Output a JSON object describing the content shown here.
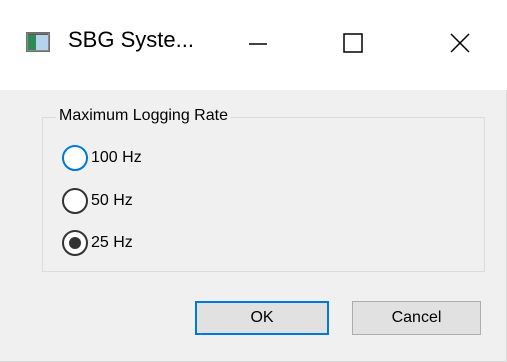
{
  "window": {
    "title": "SBG Syste...",
    "icon": "app-window-icon",
    "controls": {
      "minimize_icon": "minimize-icon",
      "maximize_icon": "maximize-icon",
      "close_icon": "close-icon"
    }
  },
  "group": {
    "label": "Maximum Logging Rate",
    "options": [
      {
        "label": "100 Hz",
        "selected": false
      },
      {
        "label": "50 Hz",
        "selected": false
      },
      {
        "label": "25 Hz",
        "selected": true
      }
    ]
  },
  "buttons": {
    "ok_label": "OK",
    "cancel_label": "Cancel"
  },
  "colors": {
    "accent": "#0078d7",
    "window_bg": "#f0f0f0",
    "titlebar_bg": "#ffffff",
    "button_bg": "#e1e1e1"
  }
}
